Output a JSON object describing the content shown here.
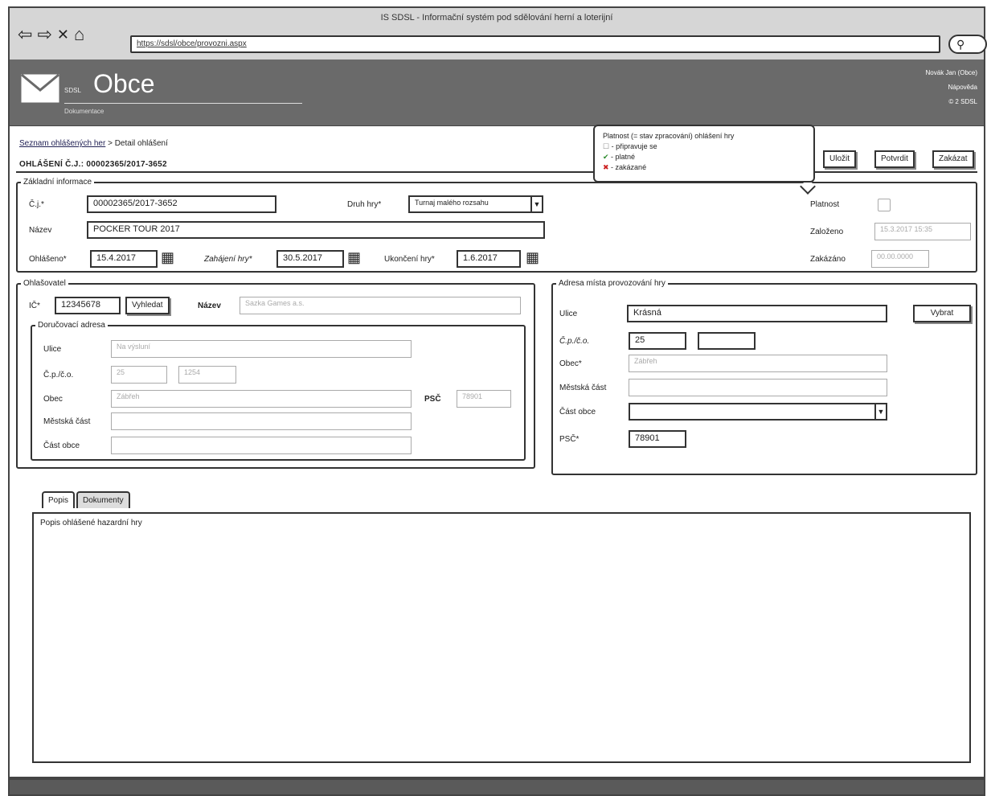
{
  "browser": {
    "title": "IS SDSL - Informační systém pod sdělování herní a loterijní",
    "url": "https://sdsl/obce/provozni.aspx",
    "nav_back": "⇦",
    "nav_forward": "⇨",
    "nav_stop": "✕",
    "nav_home": "⌂",
    "search_glyph": "⚲"
  },
  "header": {
    "app_small": "SDSL",
    "app_title": "Obce",
    "app_sub": "Dokumentace",
    "user_name": "Novák Jan (Obce)",
    "help_link": "Nápověda",
    "version": "© 2 SDSL"
  },
  "breadcrumb": {
    "link": "Seznam ohlášených her",
    "current": " > Detail ohlášení"
  },
  "heading": "OHLÁŠENÍ Č.J.: 00002365/2017-3652",
  "tooltip": {
    "title": "Platnost (= stav zpracování) ohlášení hry",
    "line1": " - připravuje se",
    "line2": " - platné",
    "line3": " - zakázané",
    "icon1": "☐",
    "icon2": "✔",
    "icon3": "✖"
  },
  "buttons": {
    "save": "Uložit",
    "confirm": "Potvrdit",
    "forbid": "Zakázat"
  },
  "basic": {
    "legend": "Základní informace",
    "cj_label": "Č.j.*",
    "cj_value": "00002365/2017-3652",
    "kind_label": "Druh hry*",
    "kind_value": "Turnaj malého rozsahu",
    "name_label": "Název",
    "name_value": "POCKER TOUR 2017",
    "announced_label": "Ohlášeno*",
    "announced_value": "15.4.2017",
    "start_label": "Zahájení hry*",
    "start_value": "30.5.2017",
    "end_label": "Ukončení hry*",
    "end_value": "1.6.2017",
    "validity_label": "Platnost",
    "created_label": "Založeno",
    "created_value": "15.3.2017 15:35",
    "forbidden_label": "Zakázáno",
    "forbidden_value": "00.00.0000"
  },
  "announcer": {
    "legend": "Ohlašovatel",
    "ico_label": "IČ*",
    "ico_value": "12345678",
    "search_btn": "Vyhledat",
    "name_label": "Název",
    "name_value": "Sazka Games a.s.",
    "delivery": {
      "legend": "Doručovací adresa",
      "street_label": "Ulice",
      "street_value": "Na výsluní",
      "number_label": "Č.p./č.o.",
      "cp_value": "25",
      "co_value": "1254",
      "town_label": "Obec",
      "town_value": "Zábřeh",
      "psc_label": "PSČ",
      "psc_value": "78901",
      "district_label": "Městská část",
      "part_label": "Část obce"
    }
  },
  "venue": {
    "legend": "Adresa místa provozování hry",
    "street_label": "Ulice",
    "street_value": "Krásná",
    "select_btn": "Vybrat",
    "number_label": "Č.p./č.o.",
    "cp_value": "25",
    "town_label": "Obec*",
    "town_value": "Zábřeh",
    "district_label": "Městská část",
    "part_label": "Část obce",
    "psc_label": "PSČ*",
    "psc_value": "78901"
  },
  "tabs": {
    "tab1": "Popis",
    "tab2": "Dokumenty",
    "panel_text": "Popis ohlášené hazardní hry"
  },
  "icons": {
    "calendar": "▦",
    "dropdown": "▼"
  }
}
